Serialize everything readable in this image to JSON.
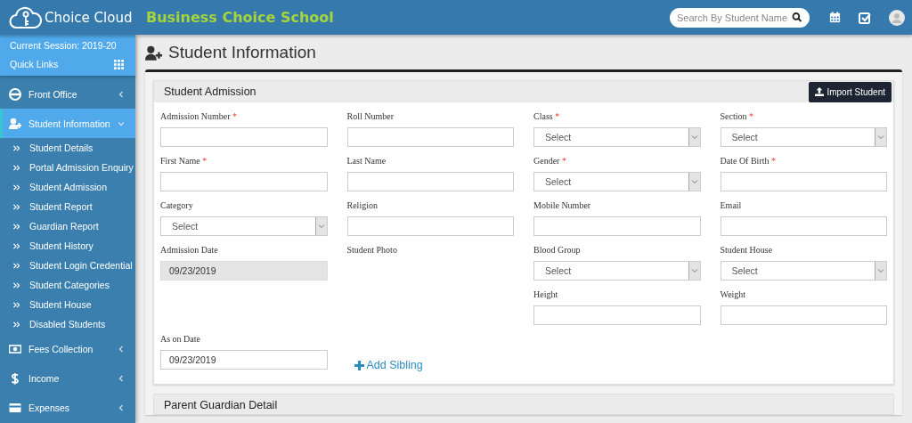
{
  "header": {
    "logo_text": "Choice Cloud",
    "school_name": "Business Choice School",
    "search": {
      "placeholder": "Search By Student Name"
    }
  },
  "sidebar": {
    "session": "Current Session: 2019-20",
    "quick_links": "Quick Links",
    "items": [
      {
        "label": "Front Office",
        "expanded": false,
        "selected": false
      },
      {
        "label": "Student Information",
        "expanded": true,
        "selected": true,
        "children": [
          {
            "label": "Student Details"
          },
          {
            "label": "Portal Admission Enquiry"
          },
          {
            "label": "Student Admission"
          },
          {
            "label": "Student Report"
          },
          {
            "label": "Guardian Report"
          },
          {
            "label": "Student History"
          },
          {
            "label": "Student Login Credential"
          },
          {
            "label": "Student Categories"
          },
          {
            "label": "Student House"
          },
          {
            "label": "Disabled Students"
          }
        ]
      },
      {
        "label": "Fees Collection",
        "expanded": false,
        "selected": false
      },
      {
        "label": "Income",
        "expanded": false,
        "selected": false
      },
      {
        "label": "Expenses",
        "expanded": false,
        "selected": false
      }
    ]
  },
  "page_title": "Student Information",
  "panel": {
    "title": "Student Admission",
    "import_button": "Import Student",
    "fields": [
      {
        "kind": "text",
        "label": "Admission Number",
        "mark": "*"
      },
      {
        "kind": "text",
        "label": "Roll Number"
      },
      {
        "kind": "select",
        "label": "Class",
        "mark": "*",
        "value": "Select"
      },
      {
        "kind": "select",
        "label": "Section",
        "mark": "*",
        "value": "Select"
      },
      {
        "kind": "text",
        "label": "First Name",
        "mark": "*"
      },
      {
        "kind": "text",
        "label": "Last Name"
      },
      {
        "kind": "select",
        "label": "Gender",
        "mark": "*",
        "value": "Select"
      },
      {
        "kind": "text",
        "label": "Date Of Birth",
        "mark": "*"
      },
      {
        "kind": "select",
        "label": "Category",
        "value": "Select"
      },
      {
        "kind": "text",
        "label": "Religion"
      },
      {
        "kind": "text",
        "label": "Mobile Number"
      },
      {
        "kind": "text",
        "label": "Email"
      },
      {
        "kind": "text",
        "label": "Admission Date",
        "value": "09/23/2019",
        "disabled": true
      },
      {
        "kind": "label",
        "label": "Student Photo"
      },
      {
        "kind": "select",
        "label": "Blood Group",
        "value": "Select"
      },
      {
        "kind": "select",
        "label": "Student House",
        "value": "Select"
      },
      {
        "kind": "text",
        "label": "Height"
      },
      {
        "kind": "text",
        "label": "Weight"
      },
      {
        "kind": "text",
        "label": "As on Date",
        "value": "09/23/2019",
        "disabled": false
      },
      {
        "kind": "link",
        "label": "Add Sibling"
      }
    ]
  },
  "next_panel": {
    "title": "Parent Guardian Detail"
  }
}
